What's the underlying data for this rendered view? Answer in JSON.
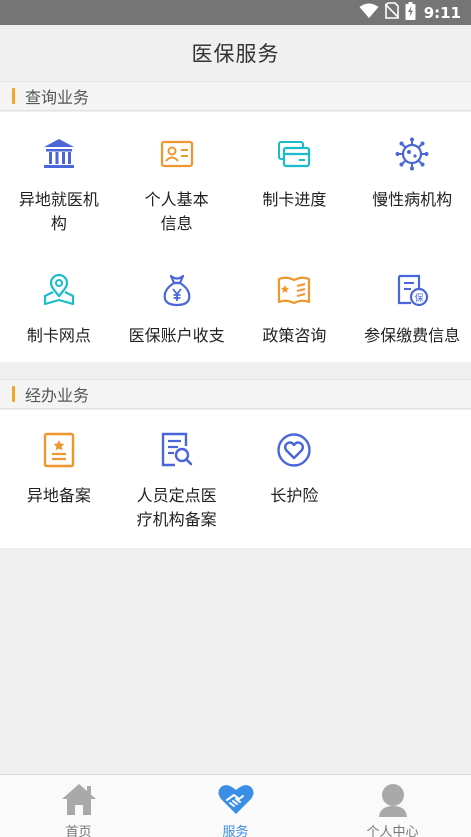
{
  "status_bar": {
    "time": "9:11",
    "icons": [
      "wifi-icon",
      "no-sim-icon",
      "battery-charging-icon"
    ]
  },
  "header": {
    "title": "医保服务"
  },
  "sections": [
    {
      "title": "查询业务",
      "items": [
        {
          "label": "异地就医机\n构",
          "icon": "bank-icon",
          "color": "#4a66d8"
        },
        {
          "label": "个人基本\n信息",
          "icon": "id-card-icon",
          "color": "#f0962f"
        },
        {
          "label": "制卡进度",
          "icon": "cards-icon",
          "color": "#1bbcc9"
        },
        {
          "label": "慢性病机构",
          "icon": "virus-icon",
          "color": "#4a66d8"
        },
        {
          "label": "制卡网点",
          "icon": "map-pin-icon",
          "color": "#1bbcc9"
        },
        {
          "label": "医保账户收支",
          "icon": "money-bag-icon",
          "color": "#4a66d8"
        },
        {
          "label": "政策咨询",
          "icon": "policy-book-icon",
          "color": "#f0962f"
        },
        {
          "label": "参保缴费信息",
          "icon": "insurance-doc-icon",
          "color": "#4a66d8"
        }
      ]
    },
    {
      "title": "经办业务",
      "items": [
        {
          "label": "异地备案",
          "icon": "star-document-icon",
          "color": "#f0962f"
        },
        {
          "label": "人员定点医\n疗机构备案",
          "icon": "search-document-icon",
          "color": "#4a66d8"
        },
        {
          "label": "长护险",
          "icon": "heart-circle-icon",
          "color": "#4a66d8"
        }
      ]
    }
  ],
  "tabbar": {
    "items": [
      {
        "label": "首页",
        "icon": "home-icon",
        "active": false
      },
      {
        "label": "服务",
        "icon": "heart-handshake-icon",
        "active": true
      },
      {
        "label": "个人中心",
        "icon": "user-icon",
        "active": false
      }
    ]
  },
  "colors": {
    "accent": "#3a8ee6",
    "section_bar": "#f5a623",
    "blue": "#4a66d8",
    "orange": "#f0962f",
    "teal": "#1bbcc9"
  }
}
